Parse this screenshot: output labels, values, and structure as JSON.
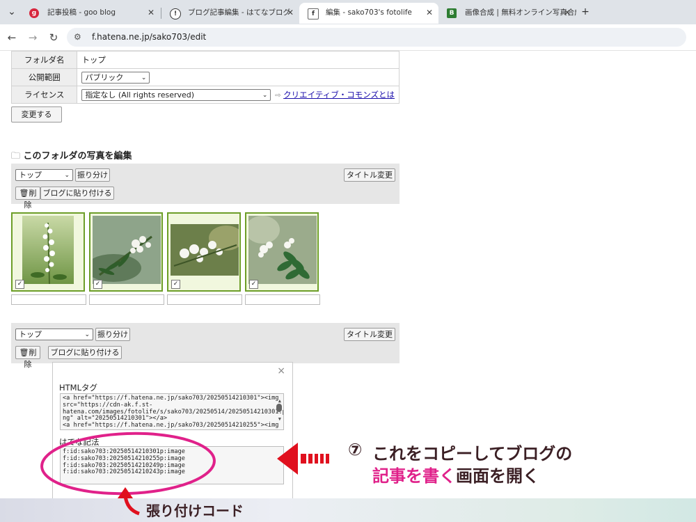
{
  "browser": {
    "tabs": [
      {
        "title": "記事投稿 - goo blog",
        "favicon": "goo-favicon",
        "active": false
      },
      {
        "title": "ブログ記事編集 - はてなブログ",
        "favicon": "hatena-blog-favicon",
        "active": false
      },
      {
        "title": "編集 - sako703's fotolife",
        "favicon": "fotolife-favicon",
        "active": true
      },
      {
        "title": "画像合成 | 無料オンライン写真合成",
        "favicon": "bg-favicon",
        "active": false
      }
    ],
    "new_tab": "+",
    "url": "f.hatena.ne.jp/sako703/edit"
  },
  "settings": {
    "rows": [
      {
        "label": "フォルダ名",
        "value": "トップ"
      },
      {
        "label": "公開範囲",
        "value": "パブリック"
      },
      {
        "label": "ライセンス",
        "value": "指定なし (All rights reserved)",
        "link": "クリエイティブ・コモンズとは"
      }
    ],
    "submit": "変更する"
  },
  "section_title": "このフォルダの写真を編集",
  "toolbar_top": {
    "folder": "トップ",
    "sort": "振り分け",
    "title_change": "タイトル変更",
    "delete": "削除",
    "paste": "ブログに貼り付ける"
  },
  "toolbar_bottom": {
    "folder": "トップ",
    "sort": "振り分け",
    "title_change": "タイトル変更",
    "delete": "削除",
    "paste": "ブログに貼り付ける"
  },
  "photos": [
    {
      "checked": true,
      "caption": ""
    },
    {
      "checked": true,
      "caption": ""
    },
    {
      "checked": true,
      "caption": ""
    },
    {
      "checked": true,
      "caption": ""
    }
  ],
  "popup": {
    "close": "×",
    "html_label": "HTMLタグ",
    "html_lines": [
      "<a href=\"https://f.hatena.ne.jp/sako703/20250514210301\"><img",
      "src=\"https://cdn-ak.f.st-",
      "hatena.com/images/fotolife/s/sako703/20250514/20250514210301.p",
      "ng\" alt=\"20250514210301\"></a>",
      "<a href=\"https://f.hatena.ne.jp/sako703/20250514210255\"><img"
    ],
    "hatena_label": "はてな記法",
    "hatena_lines": [
      "f:id:sako703:20250514210301p:image",
      "f:id:sako703:20250514210255p:image",
      "f:id:sako703:20250514210249p:image",
      "f:id:sako703:20250514210243p:image"
    ]
  },
  "annotation": {
    "number": "⑦",
    "line1": "これをコピーしてブログの",
    "line2_highlight": "記事を書く",
    "line2_rest": "画面を開く",
    "paste_code": "張り付けコード",
    "highlight_color": "#e0218a",
    "arrow_color": "#e0101e"
  }
}
